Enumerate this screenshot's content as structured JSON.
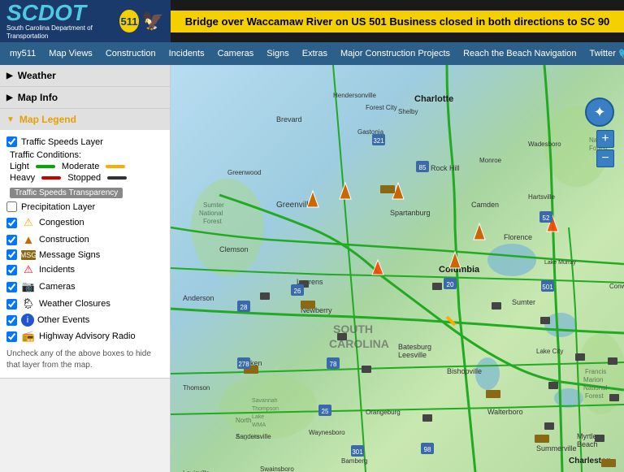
{
  "header": {
    "logo": {
      "scdot": "SCDOT",
      "subtitle": "South Carolina Department of Transportation",
      "badge": "511"
    },
    "alert": "Bridge over Waccamaw River on US 501 Business closed in both directions to SC 90"
  },
  "navbar": {
    "items": [
      {
        "label": "my511",
        "id": "my511"
      },
      {
        "label": "Map Views",
        "id": "map-views"
      },
      {
        "label": "Construction",
        "id": "construction"
      },
      {
        "label": "Incidents",
        "id": "incidents"
      },
      {
        "label": "Cameras",
        "id": "cameras"
      },
      {
        "label": "Signs",
        "id": "signs"
      },
      {
        "label": "Extras",
        "id": "extras"
      },
      {
        "label": "Major Construction Projects",
        "id": "major-construction"
      },
      {
        "label": "Reach the Beach Navigation",
        "id": "reach-beach"
      },
      {
        "label": "Twitter",
        "id": "twitter"
      }
    ]
  },
  "sidebar": {
    "weather_label": "Weather",
    "map_info_label": "Map Info",
    "map_legend_label": "Map Legend",
    "legend": {
      "traffic_speeds_layer": "Traffic Speeds Layer",
      "traffic_conditions_label": "Traffic Conditions:",
      "light_label": "Light",
      "moderate_label": "Moderate",
      "heavy_label": "Heavy",
      "stopped_label": "Stopped",
      "transparency_btn": "Traffic Speeds Transparency",
      "precipitation_label": "Precipitation Layer",
      "items": [
        {
          "label": "Congestion",
          "icon": "⚠️",
          "checked": true,
          "color": "orange"
        },
        {
          "label": "Construction",
          "icon": "🚧",
          "checked": true,
          "color": "orange"
        },
        {
          "label": "Message Signs",
          "icon": "📋",
          "checked": true,
          "color": "brown"
        },
        {
          "label": "Incidents",
          "icon": "⚠️",
          "checked": true,
          "color": "red"
        },
        {
          "label": "Cameras",
          "icon": "📷",
          "checked": true,
          "color": "gray"
        },
        {
          "label": "Weather Closures",
          "icon": "🌦️",
          "checked": true,
          "color": "blue"
        },
        {
          "label": "Other Events",
          "icon": "ℹ️",
          "checked": true,
          "color": "blue"
        },
        {
          "label": "Highway Advisory Radio",
          "icon": "📻",
          "checked": true,
          "color": "blue"
        }
      ],
      "note": "Uncheck any of the above boxes to hide that layer from the map."
    }
  }
}
